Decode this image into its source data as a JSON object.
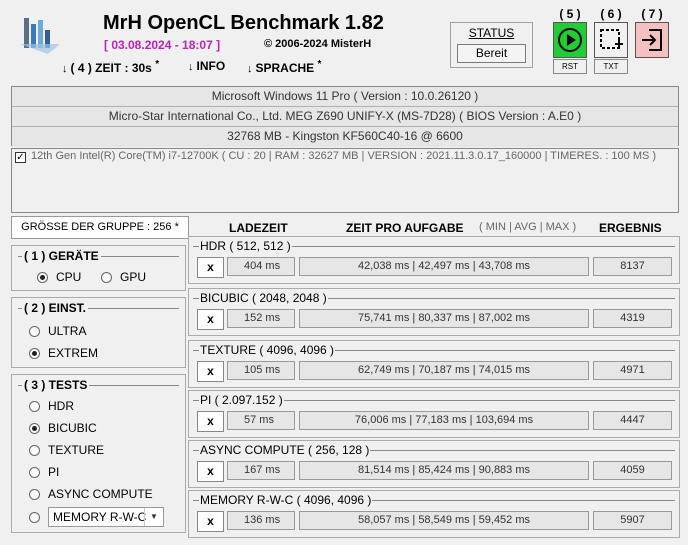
{
  "header": {
    "title": "MrH OpenCL Benchmark 1.82",
    "date": "[ 03.08.2024 - 18:07 ]",
    "copyright": "©  2006-2024 MisterH",
    "menu": {
      "zeit": "( 4 ) ZEIT : 30s",
      "info": "INFO",
      "sprache": "SPRACHE"
    },
    "menu_star": "*",
    "status_label": "STATUS",
    "status_value": "Bereit",
    "buttons": [
      {
        "num": "( 5 )",
        "icon": "play-icon",
        "sub": "RST",
        "color": "#22cc33"
      },
      {
        "num": "( 6 )",
        "icon": "selection-icon",
        "sub": "TXT",
        "color": "#f0f0f0"
      },
      {
        "num": "( 7 )",
        "icon": "exit-icon",
        "sub": "",
        "color": "#f4c0c0"
      }
    ]
  },
  "system": {
    "os": "Microsoft Windows 11 Pro ( Version : 10.0.26120 )",
    "board": "Micro-Star International Co., Ltd. MEG Z690 UNIFY-X (MS-7D28) ( BIOS Version : A.E0 )",
    "ram": "32768 MB - Kingston KF560C40-16          @ 6600",
    "cpu": "12th Gen Intel(R) Core(TM) i7-12700K ( CU : 20 | RAM : 32627 MB | VERSION : 2021.11.3.0.17_160000 | TIMERES. : 100 MS )"
  },
  "columns": {
    "group_size": "GRÖSSE DER GRUPPE : 256 *",
    "load": "LADEZEIT",
    "time_per_task": "ZEIT PRO AUFGABE",
    "min_avg_max": "( MIN | AVG | MAX )",
    "result": "ERGEBNIS"
  },
  "devices": {
    "title": "( 1 ) GERÄTE",
    "cpu": "CPU",
    "gpu": "GPU",
    "selected": "CPU"
  },
  "settings": {
    "title": "( 2 ) EINST.",
    "ultra": "ULTRA",
    "extrem": "EXTREM",
    "selected": "EXTREM"
  },
  "tests_panel": {
    "title": "( 3 ) TESTS",
    "items": [
      "HDR",
      "BICUBIC",
      "TEXTURE",
      "PI",
      "ASYNC COMPUTE",
      "MEMORY R-W-C"
    ],
    "selected": "BICUBIC"
  },
  "tests": [
    {
      "name": "HDR ( 512, 512 )",
      "x": "x",
      "load": "404 ms",
      "times": "42,038 ms | 42,497 ms | 43,708 ms",
      "result": "8137"
    },
    {
      "name": "BICUBIC ( 2048, 2048 )",
      "x": "x",
      "load": "152 ms",
      "times": "75,741 ms | 80,337 ms | 87,002 ms",
      "result": "4319"
    },
    {
      "name": "TEXTURE ( 4096, 4096 )",
      "x": "x",
      "load": "105 ms",
      "times": "62,749 ms | 70,187 ms | 74,015 ms",
      "result": "4971"
    },
    {
      "name": "PI ( 2.097.152 )",
      "x": "x",
      "load": "57 ms",
      "times": "76,006 ms | 77,183 ms | 103,694 ms",
      "result": "4447"
    },
    {
      "name": "ASYNC COMPUTE ( 256, 128 )",
      "x": "x",
      "load": "167 ms",
      "times": "81,514 ms | 85,424 ms | 90,883 ms",
      "result": "4059"
    },
    {
      "name": "MEMORY R-W-C ( 4096, 4096 )",
      "x": "x",
      "load": "136 ms",
      "times": "58,057 ms | 58,549 ms | 59,452 ms",
      "result": "5907"
    }
  ]
}
